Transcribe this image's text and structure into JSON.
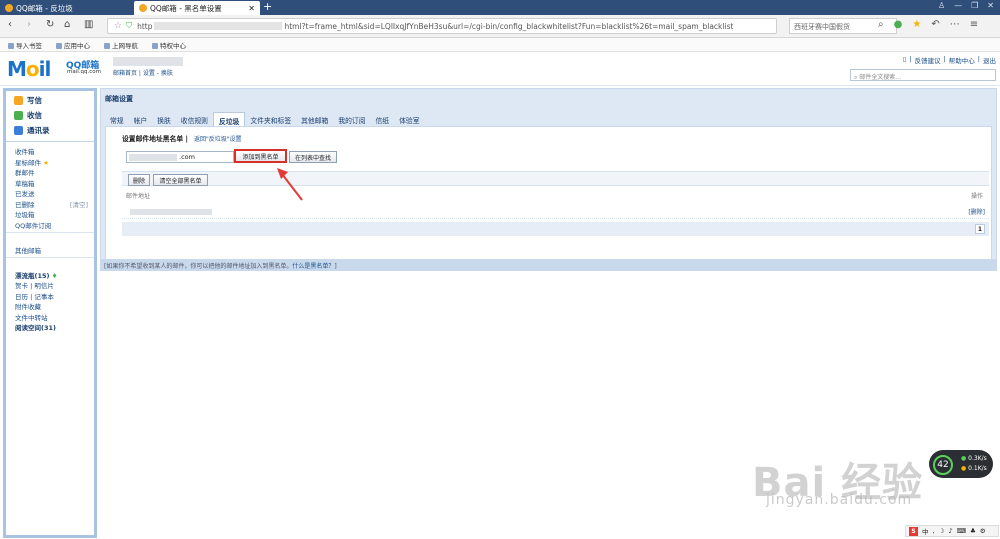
{
  "browser": {
    "tabs": [
      {
        "title": "QQ邮箱 - 反垃圾",
        "active": false
      },
      {
        "title": "QQ邮箱 - 黑名单设置",
        "active": true
      }
    ],
    "url_prefix": "http",
    "url_suffix": "html?t=frame_html&sid=LQlIxqJfYnBeH3su&url=/cgi-bin/config_blackwhitelist?Fun=blacklist%26t=mail_spam_blacklist",
    "search_placeholder": "西班牙赛中国假货",
    "bookmarks": [
      "导入书签",
      "应用中心",
      "上网导航",
      "特权中心"
    ]
  },
  "mail_header": {
    "logo_cn": "QQ邮箱",
    "logo_domain": "mail.qq.com",
    "account_links": [
      "邮箱首页",
      "设置",
      "换肤"
    ],
    "top_links": [
      "反馈建议",
      "帮助中心",
      "退出"
    ],
    "search_placeholder": "邮件全文搜索..."
  },
  "left_nav": {
    "compose": "写信",
    "inbox_main": "收信",
    "contacts": "通讯录",
    "folders": [
      {
        "label": "收件箱"
      },
      {
        "label": "星标邮件"
      },
      {
        "label": "群邮件"
      },
      {
        "label": "草稿箱"
      },
      {
        "label": "已发送"
      },
      {
        "label": "已删除",
        "extra": "[清空]"
      },
      {
        "label": "垃圾箱"
      },
      {
        "label": "QQ邮件订阅"
      }
    ],
    "other_mail": "其他邮箱",
    "drift_bottle": "漂流瓶(15)",
    "cards": "贺卡",
    "postcards": "明信片",
    "calendar": "日历",
    "notebook": "记事本",
    "attachments": "附件收藏",
    "file_transfer": "文件中转站",
    "reading": "阅读空间(31)"
  },
  "settings": {
    "title": "邮箱设置",
    "tabs": [
      "常规",
      "帐户",
      "换肤",
      "收信规则",
      "反垃圾",
      "文件夹和标签",
      "其他邮箱",
      "我的订阅",
      "信纸",
      "体验室"
    ],
    "active_tab": "反垃圾",
    "panel_title": "设置邮件地址黑名单",
    "back_link": "返回\"反垃圾\"设置",
    "input_value": ".com",
    "add_button": "添加到黑名单",
    "find_button": "在列表中查找",
    "delete_button": "删除",
    "clear_button": "清空全部黑名单",
    "col_address": "邮件地址",
    "col_action": "操作",
    "row_action": "[删除]",
    "page": "1",
    "tip": "[如果你不希望收到某人的邮件，你可以把他的邮件地址加入到黑名单。",
    "tip_link": "什么是黑名单？",
    "tip_end": "]"
  },
  "widgets": {
    "speed_value": "42",
    "upload": "0.3K/s",
    "download": "0.1K/s",
    "ime_label": "中"
  },
  "watermark": {
    "brand": "Bai 经验",
    "url": "jingyan.baidu.com"
  },
  "colors": {
    "tabbar": "#2f4f7a",
    "accent": "#1a73c8",
    "highlight_border": "#d93025",
    "panel_bg": "#dde8f4"
  }
}
